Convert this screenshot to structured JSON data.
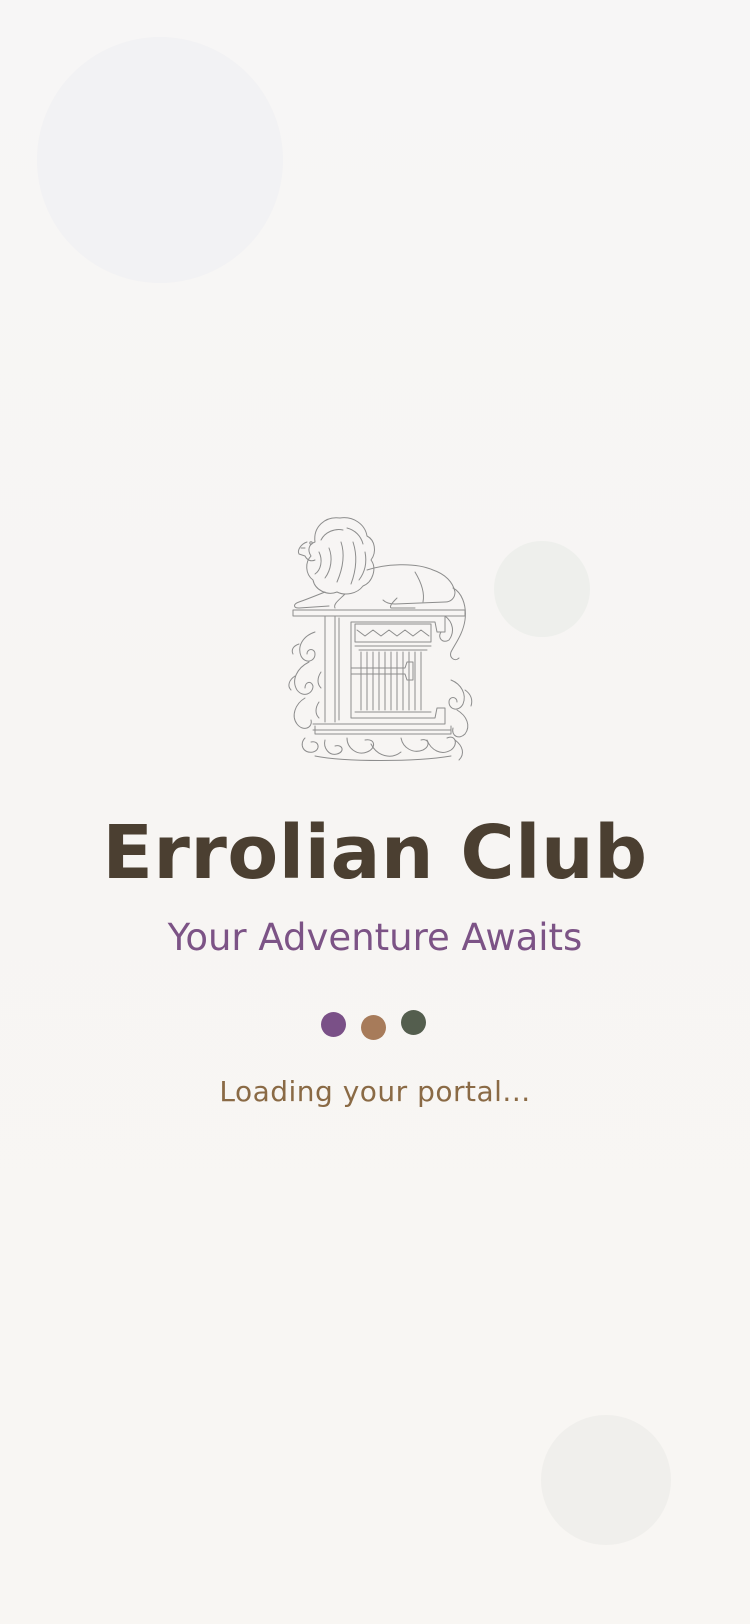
{
  "app": {
    "title": "Errolian Club",
    "tagline": "Your Adventure Awaits",
    "loading_text": "Loading your portal..."
  },
  "logo": {
    "icon": "lion-monogram-e-icon"
  },
  "loader": {
    "dots": [
      {
        "name": "loading-dot-purple",
        "color": "#7a5087"
      },
      {
        "name": "loading-dot-tan",
        "color": "#a77b5a"
      },
      {
        "name": "loading-dot-green",
        "color": "#545e4e"
      }
    ]
  },
  "colors": {
    "title": "#4b3f31",
    "tagline": "#7c5386",
    "loading": "#8a6a45"
  }
}
